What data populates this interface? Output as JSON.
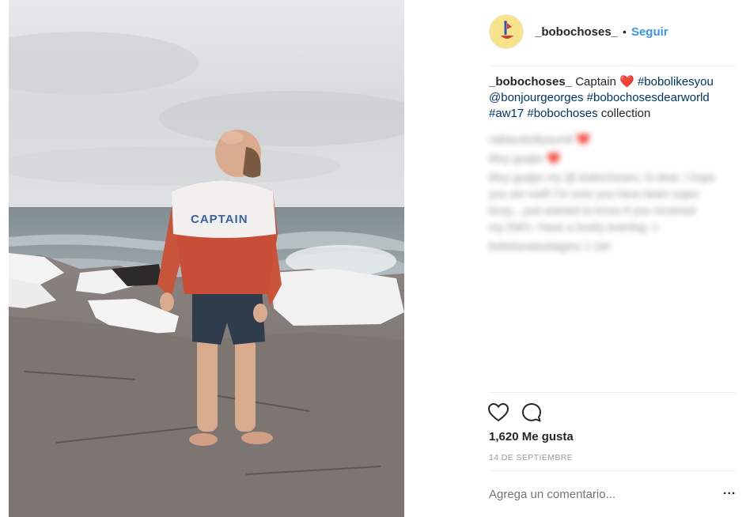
{
  "post": {
    "username": "_bobochoses_",
    "dot": "•",
    "follow_label": "Seguir",
    "avatar_icon": "bobochoses-logo-icon",
    "photo": {
      "alt_icon": "child-on-rocky-shore-photo",
      "sweater_text": "CAPTAIN"
    },
    "caption": {
      "username": "_bobochoses_",
      "text": "Captain",
      "emoji": "❤️",
      "tag1": "#bobolikesyou",
      "mention": "@bonjourgeorges",
      "tag2": "#bobochosesdearworld",
      "tag3": "#aw17",
      "tag4": "#bobochoses",
      "tail": "collection"
    },
    "comments_blurred": [
      "raibaustuflyaum8 ❤️",
      "Muy guapo ❤️",
      "Muy guapo my @ bobochoses, hi dear, I hope",
      "you are well! I'm sure you have been super",
      "busy... just wanted to know if you received",
      "my DM's. Have a lovely evening ☺",
      "bobelunaisuitaginu 1 ciel"
    ],
    "actions": {
      "like_icon": "heart-outline-icon",
      "comment_icon": "comment-bubble-icon"
    },
    "likes_text": "1,620 Me gusta",
    "date_text": "14 DE SEPTIEMBRE",
    "comment_placeholder": "Agrega un comentario...",
    "more_label": "...",
    "colors": {
      "link": "#003569",
      "follow": "#3897f0",
      "heart": "#ed4956"
    }
  }
}
